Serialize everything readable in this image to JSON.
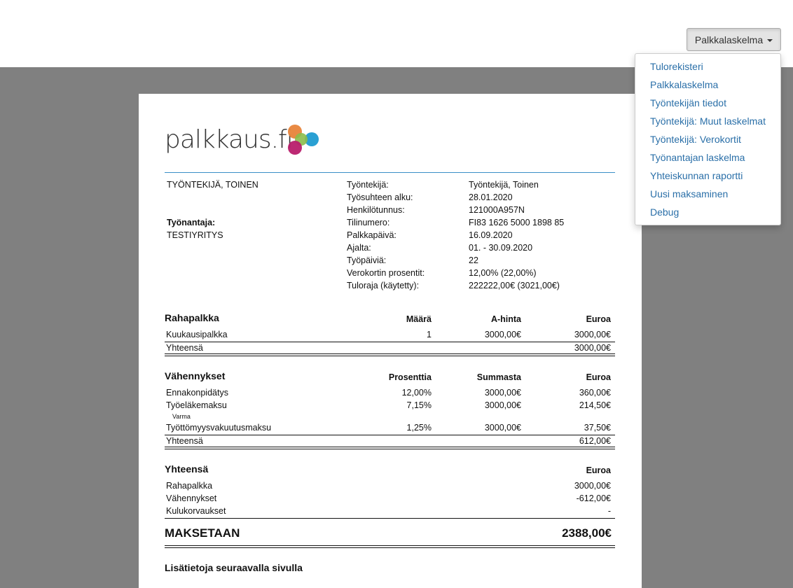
{
  "dropdown": {
    "label": "Palkkalaskelma",
    "items": [
      "Tulorekisteri",
      "Palkkalaskelma",
      "Työntekijän tiedot",
      "Työntekijä: Muut laskelmat",
      "Työntekijä: Verokortit",
      "Työnantajan laskelma",
      "Yhteiskunnan raportti",
      "Uusi maksaminen",
      "Debug"
    ]
  },
  "logo": {
    "text": "palkkaus.fi",
    "dot_colors": [
      "#e8843a",
      "#1f9bd1",
      "#8bbd4b",
      "#b81d6b"
    ]
  },
  "employee_name": "TYÖNTEKIJÄ, TOINEN",
  "employer_label": "Työnantaja:",
  "employer_name": "TESTIYRITYS",
  "details": [
    {
      "label": "Työntekijä:",
      "value": "Työntekijä, Toinen"
    },
    {
      "label": "Työsuhteen alku:",
      "value": "28.01.2020"
    },
    {
      "label": "Henkilötunnus:",
      "value": "121000A957N"
    },
    {
      "label": "Tilinumero:",
      "value": "FI83 1626 5000 1898 85"
    },
    {
      "label": "Palkkapäivä:",
      "value": "16.09.2020"
    },
    {
      "label": "Ajalta:",
      "value": "01. - 30.09.2020"
    },
    {
      "label": "Työpäiviä:",
      "value": "22"
    },
    {
      "label": "Verokortin prosentit:",
      "value": "12,00% (22,00%)"
    },
    {
      "label": "Tuloraja (käytetty):",
      "value": "222222,00€ (3021,00€)"
    }
  ],
  "rahapalkka": {
    "title": "Rahapalkka",
    "headers": [
      "Määrä",
      "A-hinta",
      "Euroa"
    ],
    "rows": [
      {
        "label": "Kuukausipalkka",
        "c1": "1",
        "c2": "3000,00€",
        "c3": "3000,00€"
      }
    ],
    "total_label": "Yhteensä",
    "total": "3000,00€"
  },
  "vahennykset": {
    "title": "Vähennykset",
    "headers": [
      "Prosenttia",
      "Summasta",
      "Euroa"
    ],
    "rows": [
      {
        "label": "Ennakonpidätys",
        "c1": "12,00%",
        "c2": "3000,00€",
        "c3": "360,00€",
        "sub": ""
      },
      {
        "label": "Työeläkemaksu",
        "c1": "7,15%",
        "c2": "3000,00€",
        "c3": "214,50€",
        "sub": "Varma"
      },
      {
        "label": "Työttömyysvakuutusmaksu",
        "c1": "1,25%",
        "c2": "3000,00€",
        "c3": "37,50€",
        "sub": ""
      }
    ],
    "total_label": "Yhteensä",
    "total": "612,00€"
  },
  "yhteensa": {
    "title": "Yhteensä",
    "header": "Euroa",
    "rows": [
      {
        "label": "Rahapalkka",
        "value": "3000,00€"
      },
      {
        "label": "Vähennykset",
        "value": "-612,00€"
      },
      {
        "label": "Kulukorvaukset",
        "value": "-"
      }
    ]
  },
  "maksetaan": {
    "label": "MAKSETAAN",
    "value": "2388,00€"
  },
  "footer_note": "Lisätietoja seuraavalla sivulla"
}
